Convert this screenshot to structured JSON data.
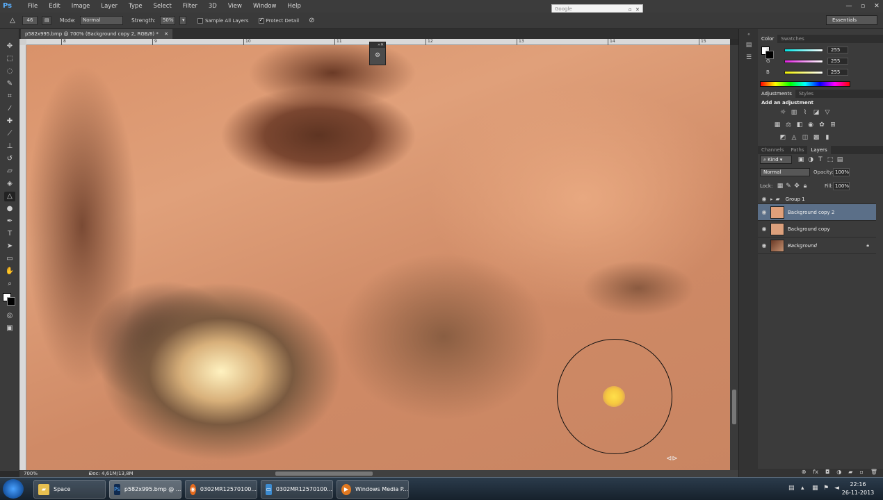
{
  "app": {
    "logo": "Ps"
  },
  "menu": [
    "File",
    "Edit",
    "Image",
    "Layer",
    "Type",
    "Select",
    "Filter",
    "3D",
    "View",
    "Window",
    "Help"
  ],
  "browser_box": {
    "text": "Google"
  },
  "options": {
    "brush_size": "46",
    "mode_label": "Mode:",
    "mode_value": "Normal",
    "strength_label": "Strength:",
    "strength_value": "50%",
    "sample_all_layers": "Sample All Layers",
    "protect_detail": "Protect Detail",
    "workspace": "Essentials"
  },
  "document": {
    "tab_title": "p582x995.bmp @ 700% (Background copy 2, RGB/8) *",
    "zoom": "700%",
    "doc_size": "Doc: 4,61M/13,8M",
    "ruler_marks": [
      "8",
      "9",
      "10",
      "11",
      "12",
      "13",
      "14",
      "15"
    ]
  },
  "color_panel": {
    "tabs": [
      "Color",
      "Swatches"
    ],
    "channels": [
      {
        "label": "R",
        "value": "255",
        "color": "#00e5e5"
      },
      {
        "label": "G",
        "value": "255",
        "color": "#e020e0"
      },
      {
        "label": "B",
        "value": "255",
        "color": "#f0f000"
      }
    ]
  },
  "adjustments_panel": {
    "tabs": [
      "Adjustments",
      "Styles"
    ],
    "title": "Add an adjustment"
  },
  "layers_panel": {
    "tabs": [
      "Channels",
      "Paths",
      "Layers"
    ],
    "filter": "Kind",
    "blend_mode": "Normal",
    "opacity_label": "Opacity:",
    "opacity_value": "100%",
    "lock_label": "Lock:",
    "fill_label": "Fill:",
    "fill_value": "100%",
    "layers": [
      {
        "name": "Group 1",
        "type": "group"
      },
      {
        "name": "Background copy 2",
        "selected": true
      },
      {
        "name": "Background copy"
      },
      {
        "name": "Background",
        "locked": true
      }
    ]
  },
  "taskbar": {
    "items": [
      {
        "label": "Space",
        "icon": "folder-icon"
      },
      {
        "label": "p582x995.bmp @ ...",
        "icon": "photoshop-icon",
        "active": true
      },
      {
        "label": "0302MR12570100...",
        "icon": "firefox-icon"
      },
      {
        "label": "0302MR12570100...",
        "icon": "photo-viewer-icon"
      },
      {
        "label": "Windows Media P...",
        "icon": "media-player-icon"
      }
    ],
    "time": "22:16",
    "date": "26-11-2013"
  }
}
